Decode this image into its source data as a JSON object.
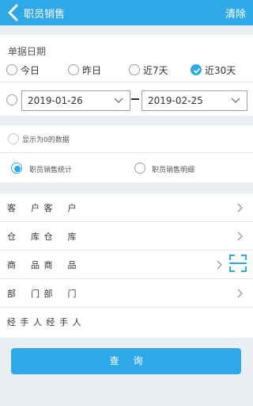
{
  "header": {
    "title": "职员销售",
    "clear_label": "清除"
  },
  "date_section": {
    "label": "单据日期",
    "presets": [
      "今日",
      "昨日",
      "近7天",
      "近30天"
    ],
    "selected_preset": "近30天",
    "start_date": "2019-01-26",
    "end_date": "2019-02-25"
  },
  "options": {
    "show_zero_label": "显示为0的数据",
    "report_types": [
      "职员销售统计",
      "职员销售明细"
    ],
    "selected_report": "职员销售统计"
  },
  "filters": [
    {
      "label": "客    户 客    户"
    },
    {
      "label": "仓    库 仓    库"
    },
    {
      "label": "商    品 商    品"
    },
    {
      "label": "部    门 部    门"
    },
    {
      "label": "经 手 人 经 手 人"
    }
  ],
  "query_label": "查询",
  "colors": {
    "accent": "#2fa8e8",
    "background": "#e9eef1"
  }
}
